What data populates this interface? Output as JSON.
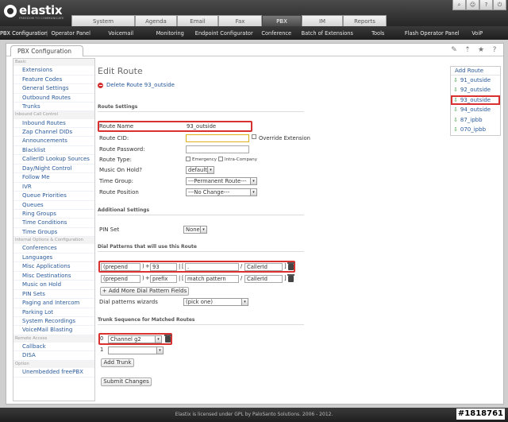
{
  "header": {
    "logo_text": "elastix",
    "logo_sub": "FREEDOM TO COMMUNICATE",
    "tabs": [
      "System",
      "Agenda",
      "Email",
      "Fax",
      "PBX",
      "IM",
      "Reports"
    ],
    "active_tab": "PBX",
    "icons": [
      "search-icon",
      "user-icon",
      "help-icon",
      "logout-icon"
    ]
  },
  "modules": [
    "PBX Configuration",
    "Operator Panel",
    "Voicemail",
    "Monitoring",
    "Endpoint Configurator",
    "Conference",
    "Batch of Extensions",
    "Tools",
    "Flash Operator Panel",
    "VoiP"
  ],
  "page_tab": "PBX Configuration",
  "nav": [
    {
      "type": "section",
      "label": "Basic"
    },
    {
      "type": "item",
      "label": "Extensions"
    },
    {
      "type": "item",
      "label": "Feature Codes"
    },
    {
      "type": "item",
      "label": "General Settings"
    },
    {
      "type": "item",
      "label": "Outbound Routes"
    },
    {
      "type": "item",
      "label": "Trunks"
    },
    {
      "type": "section",
      "label": "Inbound Call Control"
    },
    {
      "type": "item",
      "label": "Inbound Routes"
    },
    {
      "type": "item",
      "label": "Zap Channel DIDs"
    },
    {
      "type": "item",
      "label": "Announcements"
    },
    {
      "type": "item",
      "label": "Blacklist"
    },
    {
      "type": "item",
      "label": "CallerID Lookup Sources"
    },
    {
      "type": "item",
      "label": "Day/Night Control"
    },
    {
      "type": "item",
      "label": "Follow Me"
    },
    {
      "type": "item",
      "label": "IVR"
    },
    {
      "type": "item",
      "label": "Queue Priorities"
    },
    {
      "type": "item",
      "label": "Queues"
    },
    {
      "type": "item",
      "label": "Ring Groups"
    },
    {
      "type": "item",
      "label": "Time Conditions"
    },
    {
      "type": "item",
      "label": "Time Groups"
    },
    {
      "type": "section",
      "label": "Internal Options & Configuration"
    },
    {
      "type": "item",
      "label": "Conferences"
    },
    {
      "type": "item",
      "label": "Languages"
    },
    {
      "type": "item",
      "label": "Misc Applications"
    },
    {
      "type": "item",
      "label": "Misc Destinations"
    },
    {
      "type": "item",
      "label": "Music on Hold"
    },
    {
      "type": "item",
      "label": "PIN Sets"
    },
    {
      "type": "item",
      "label": "Paging and Intercom"
    },
    {
      "type": "item",
      "label": "Parking Lot"
    },
    {
      "type": "item",
      "label": "System Recordings"
    },
    {
      "type": "item",
      "label": "VoiceMail Blasting"
    },
    {
      "type": "section",
      "label": "Remote Access"
    },
    {
      "type": "item",
      "label": "Callback"
    },
    {
      "type": "item",
      "label": "DISA"
    },
    {
      "type": "section",
      "label": "Option"
    },
    {
      "type": "item",
      "label": "Unembedded freePBX"
    }
  ],
  "form": {
    "title": "Edit Route",
    "delete_link": "Delete Route 93_outside",
    "section_route": "Route Settings",
    "route_name_label": "Route Name",
    "route_name_value": "93_outside",
    "route_cid_label": "Route CID:",
    "route_cid_value": "",
    "override_label": "Override Extension",
    "route_password_label": "Route Password:",
    "route_type_label": "Route Type:",
    "emergency_label": "Emergency",
    "intracompany_label": "Intra-Company",
    "moh_label": "Music On Hold?",
    "moh_value": "default",
    "time_group_label": "Time Group:",
    "time_group_value": "---Permanent Route---",
    "route_position_label": "Route Position",
    "route_position_value": "---No Change---",
    "section_additional": "Additional Settings",
    "pin_set_label": "PIN Set",
    "pin_set_value": "None",
    "section_patterns": "Dial Patterns that will use this Route",
    "pattern1": {
      "prepend": "(prepend",
      "close": ")",
      "plus": "+",
      "prefix": "93",
      "pipe": "|",
      "bracket": "[",
      "match": ".",
      "slash": "/",
      "callerid": "CallerId",
      "end": "]"
    },
    "pattern2": {
      "prepend": "(prepend",
      "close": ")",
      "plus": "+",
      "prefix": "prefix",
      "pipe": "|",
      "bracket": "[",
      "match": "match pattern",
      "slash": "/",
      "callerid": "CallerId",
      "end": "]"
    },
    "add_more_label": "+ Add More Dial Pattern Fields",
    "wizards_label": "Dial patterns wizards",
    "wizards_value": "(pick one)",
    "section_trunk": "Trunk Sequence for Matched Routes",
    "trunk0_index": "0",
    "trunk0_value": "Channel g2",
    "trunk1_index": "1",
    "trunk1_value": "",
    "add_trunk_label": "Add Trunk",
    "submit_label": "Submit Changes"
  },
  "routes": {
    "add_label": "Add Route",
    "items": [
      "91_outside",
      "92_outside",
      "93_outside",
      "94_outside",
      "87_ipbb",
      "070_ipbb"
    ],
    "selected": "93_outside"
  },
  "footer": "Elastix is licensed under GPL by PaloSanto Solutions. 2006 - 2012.",
  "watermark": "#1818761"
}
